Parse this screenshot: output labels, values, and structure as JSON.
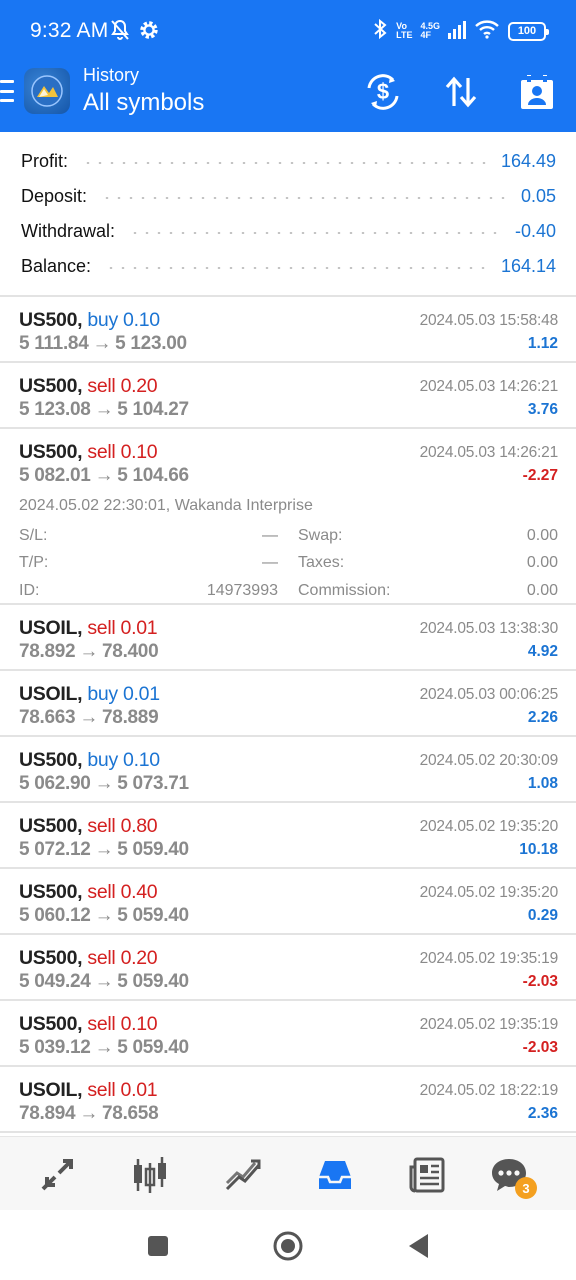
{
  "status_bar": {
    "time": "9:32 AM",
    "network_top": "Vo",
    "network_bottom": "LTE",
    "speed_top": "4.5G",
    "speed_bottom": "4F",
    "battery": "100",
    "icons": [
      "muted-bell-icon",
      "settings-gear-icon",
      "bluetooth-icon",
      "signal-icon",
      "wifi-icon",
      "battery-icon"
    ]
  },
  "app_bar": {
    "subtitle": "History",
    "title": "All symbols",
    "actions": [
      "dollar-exchange-icon",
      "sort-icon",
      "calendar-user-icon"
    ]
  },
  "summary": {
    "profit_label": "Profit:",
    "profit_value": "164.49",
    "deposit_label": "Deposit:",
    "deposit_value": "0.05",
    "withdrawal_label": "Withdrawal:",
    "withdrawal_value": "-0.40",
    "balance_label": "Balance:",
    "balance_value": "164.14"
  },
  "deals": [
    {
      "symbol": "US500,",
      "side": "buy",
      "volume": "0.10",
      "open": "5 111.84",
      "close": "5 123.00",
      "time": "2024.05.03 15:58:48",
      "profit": "1.12"
    },
    {
      "symbol": "US500,",
      "side": "sell",
      "volume": "0.20",
      "open": "5 123.08",
      "close": "5 104.27",
      "time": "2024.05.03 14:26:21",
      "profit": "3.76"
    },
    {
      "symbol": "US500,",
      "side": "sell",
      "volume": "0.10",
      "open": "5 082.01",
      "close": "5 104.66",
      "time": "2024.05.03 14:26:21",
      "profit": "-2.27"
    },
    {
      "symbol": "USOIL,",
      "side": "sell",
      "volume": "0.01",
      "open": "78.892",
      "close": "78.400",
      "time": "2024.05.03 13:38:30",
      "profit": "4.92"
    },
    {
      "symbol": "USOIL,",
      "side": "buy",
      "volume": "0.01",
      "open": "78.663",
      "close": "78.889",
      "time": "2024.05.03 00:06:25",
      "profit": "2.26"
    },
    {
      "symbol": "US500,",
      "side": "buy",
      "volume": "0.10",
      "open": "5 062.90",
      "close": "5 073.71",
      "time": "2024.05.02 20:30:09",
      "profit": "1.08"
    },
    {
      "symbol": "US500,",
      "side": "sell",
      "volume": "0.80",
      "open": "5 072.12",
      "close": "5 059.40",
      "time": "2024.05.02 19:35:20",
      "profit": "10.18"
    },
    {
      "symbol": "US500,",
      "side": "sell",
      "volume": "0.40",
      "open": "5 060.12",
      "close": "5 059.40",
      "time": "2024.05.02 19:35:20",
      "profit": "0.29"
    },
    {
      "symbol": "US500,",
      "side": "sell",
      "volume": "0.20",
      "open": "5 049.24",
      "close": "5 059.40",
      "time": "2024.05.02 19:35:19",
      "profit": "-2.03"
    },
    {
      "symbol": "US500,",
      "side": "sell",
      "volume": "0.10",
      "open": "5 039.12",
      "close": "5 059.40",
      "time": "2024.05.02 19:35:19",
      "profit": "-2.03"
    },
    {
      "symbol": "USOIL,",
      "side": "sell",
      "volume": "0.01",
      "open": "78.894",
      "close": "78.658",
      "time": "2024.05.02 18:22:19",
      "profit": "2.36"
    }
  ],
  "arrow": "→",
  "expanded_deal": {
    "open_info": "2024.05.02 22:30:01, Wakanda Interprise",
    "sl_label": "S/L:",
    "sl_value": "—",
    "tp_label": "T/P:",
    "tp_value": "—",
    "id_label": "ID:",
    "id_value": "14973993",
    "swap_label": "Swap:",
    "swap_value": "0.00",
    "taxes_label": "Taxes:",
    "taxes_value": "0.00",
    "commission_label": "Commission:",
    "commission_value": "0.00"
  },
  "bottom_nav": {
    "items": [
      "quotes-icon",
      "chart-icon",
      "trade-icon",
      "history-icon",
      "news-icon",
      "chat-icon"
    ],
    "active": "history-icon",
    "chat_badge": "3"
  },
  "colors": {
    "accent": "#1976f3",
    "positive": "#1b74d3",
    "negative": "#d42020",
    "muted": "#8a8a8a"
  }
}
